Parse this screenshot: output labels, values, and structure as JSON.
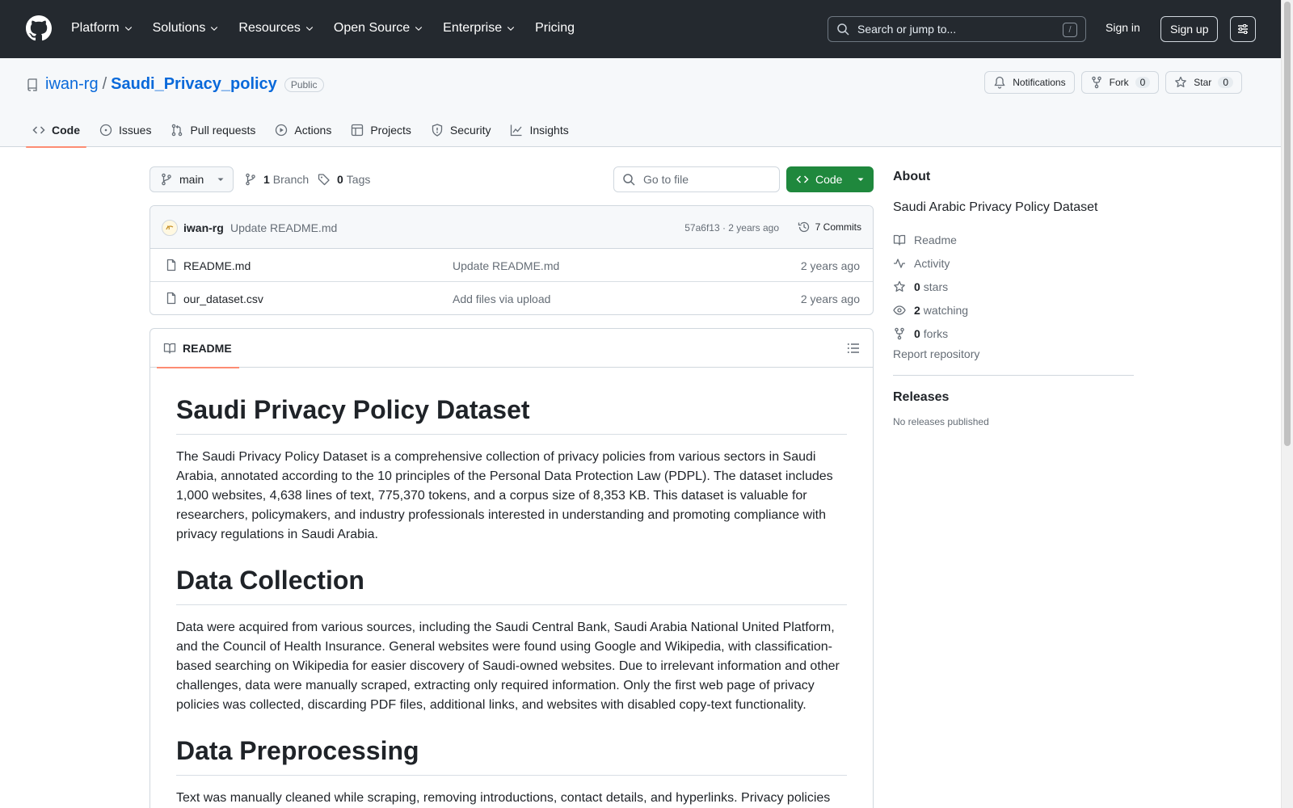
{
  "header": {
    "nav": [
      "Platform",
      "Solutions",
      "Resources",
      "Open Source",
      "Enterprise",
      "Pricing"
    ],
    "search_placeholder": "Search or jump to...",
    "search_key": "/",
    "sign_in": "Sign in",
    "sign_up": "Sign up"
  },
  "repo": {
    "owner": "iwan-rg",
    "separator": "/",
    "name": "Saudi_Privacy_policy",
    "visibility": "Public",
    "notifications": "Notifications",
    "fork_label": "Fork",
    "fork_count": "0",
    "star_label": "Star",
    "star_count": "0"
  },
  "tabs": [
    "Code",
    "Issues",
    "Pull requests",
    "Actions",
    "Projects",
    "Security",
    "Insights"
  ],
  "branch_bar": {
    "branch": "main",
    "branch_count": "1",
    "branch_label": "Branch",
    "tag_count": "0",
    "tag_label": "Tags",
    "goto_file": "Go to file",
    "code_button": "Code"
  },
  "latest_commit": {
    "author": "iwan-rg",
    "message": "Update README.md",
    "sha_time": "57a6f13 · 2 years ago",
    "commits": "7 Commits"
  },
  "files": [
    {
      "name": "README.md",
      "message": "Update README.md",
      "date": "2 years ago"
    },
    {
      "name": "our_dataset.csv",
      "message": "Add files via upload",
      "date": "2 years ago"
    }
  ],
  "readme": {
    "tab_label": "README",
    "title": "Saudi Privacy Policy Dataset",
    "intro": "The Saudi Privacy Policy Dataset is a comprehensive collection of privacy policies from various sectors in Saudi Arabia, annotated according to the 10 principles of the Personal Data Protection Law (PDPL). The dataset includes 1,000 websites, 4,638 lines of text, 775,370 tokens, and a corpus size of 8,353 KB. This dataset is valuable for researchers, policymakers, and industry professionals interested in understanding and promoting compliance with privacy regulations in Saudi Arabia.",
    "h_collection": "Data Collection",
    "collection": "Data were acquired from various sources, including the Saudi Central Bank, Saudi Arabia National United Platform, and the Council of Health Insurance. General websites were found using Google and Wikipedia, with classification-based searching on Wikipedia for easier discovery of Saudi-owned websites. Due to irrelevant information and other challenges, data were manually scraped, extracting only required information. Only the first web page of privacy policies was collected, discarding PDF files, additional links, and websites with disabled copy-text functionality.",
    "h_preprocessing": "Data Preprocessing",
    "preprocessing": "Text was manually cleaned while scraping, removing introductions, contact details, and hyperlinks. Privacy policies"
  },
  "sidebar": {
    "about": "About",
    "description": "Saudi Arabic Privacy Policy Dataset",
    "readme": "Readme",
    "activity": "Activity",
    "stars_count": "0",
    "stars_label": "stars",
    "watching_count": "2",
    "watching_label": "watching",
    "forks_count": "0",
    "forks_label": "forks",
    "report": "Report repository",
    "releases": "Releases",
    "no_releases": "No releases published"
  }
}
